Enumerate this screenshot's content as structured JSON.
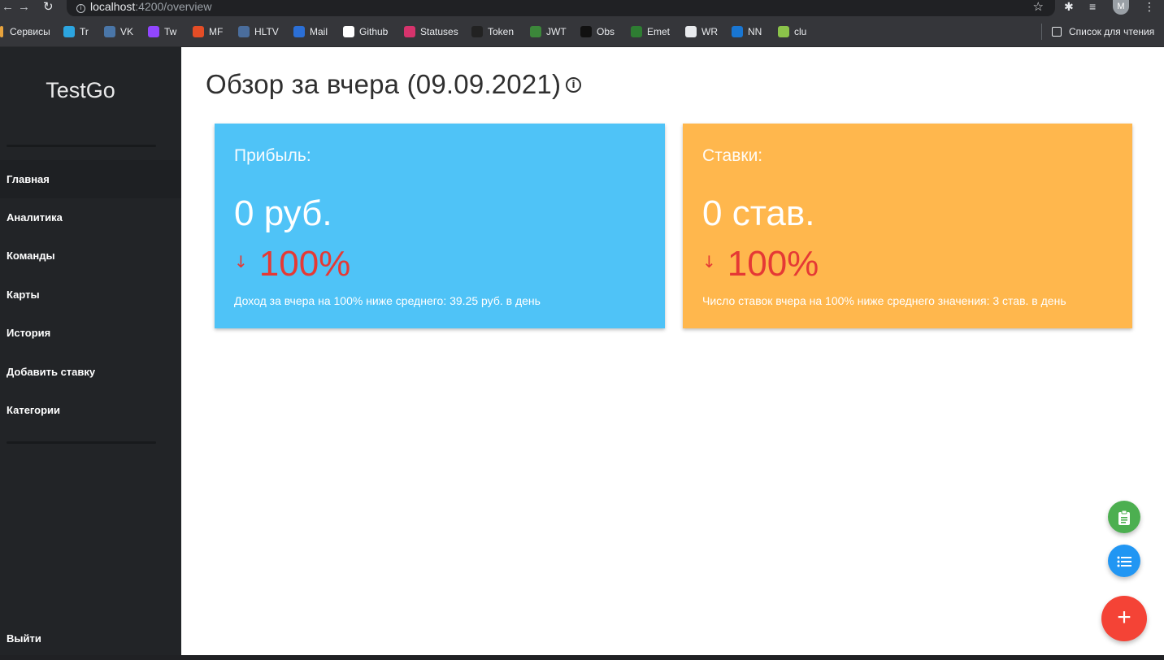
{
  "browser": {
    "url_host": "localhost",
    "url_path": ":4200/overview",
    "avatar_letter": "M",
    "bookmarks": [
      {
        "label": "Сервисы",
        "color": "#e8a33d"
      },
      {
        "label": "Tr",
        "color": "#2ca5e0"
      },
      {
        "label": "VK",
        "color": "#4a76a8"
      },
      {
        "label": "Tw",
        "color": "#9146ff"
      },
      {
        "label": "MF",
        "color": "#e44d26"
      },
      {
        "label": "HLTV",
        "color": "#4a6d9c"
      },
      {
        "label": "Mail",
        "color": "#2b6fd6"
      },
      {
        "label": "Github",
        "color": "#ffffff"
      },
      {
        "label": "Statuses",
        "color": "#d6336c"
      },
      {
        "label": "Token",
        "color": "#222222"
      },
      {
        "label": "JWT",
        "color": "#3c873a"
      },
      {
        "label": "Obs",
        "color": "#111111"
      },
      {
        "label": "Emet",
        "color": "#2e7d32"
      },
      {
        "label": "WR",
        "color": "#e8eaed"
      },
      {
        "label": "NN",
        "color": "#1976d2"
      },
      {
        "label": "clu",
        "color": "#8bc34a"
      }
    ],
    "reading_list": "Список для чтения"
  },
  "sidebar": {
    "brand": "TestGo",
    "items": [
      {
        "label": "Главная"
      },
      {
        "label": "Аналитика"
      },
      {
        "label": "Команды"
      },
      {
        "label": "Карты"
      },
      {
        "label": "История"
      },
      {
        "label": "Добавить ставку"
      },
      {
        "label": "Категории"
      }
    ],
    "logout": "Выйти"
  },
  "main": {
    "title": "Обзор за вчера (09.09.2021)",
    "cards": {
      "profit": {
        "label": "Прибыль:",
        "value": "0 руб.",
        "change": "100%",
        "note": "Доход за вчера на 100% ниже среднего: 39.25 руб. в день",
        "color": "#4fc3f7"
      },
      "bets": {
        "label": "Ставки:",
        "value": "0 став.",
        "change": "100%",
        "note": "Число ставок вчера на 100% ниже среднего значения: 3 став. в день",
        "color": "#ffb74d"
      }
    },
    "fab": {
      "add_symbol": "+"
    }
  }
}
